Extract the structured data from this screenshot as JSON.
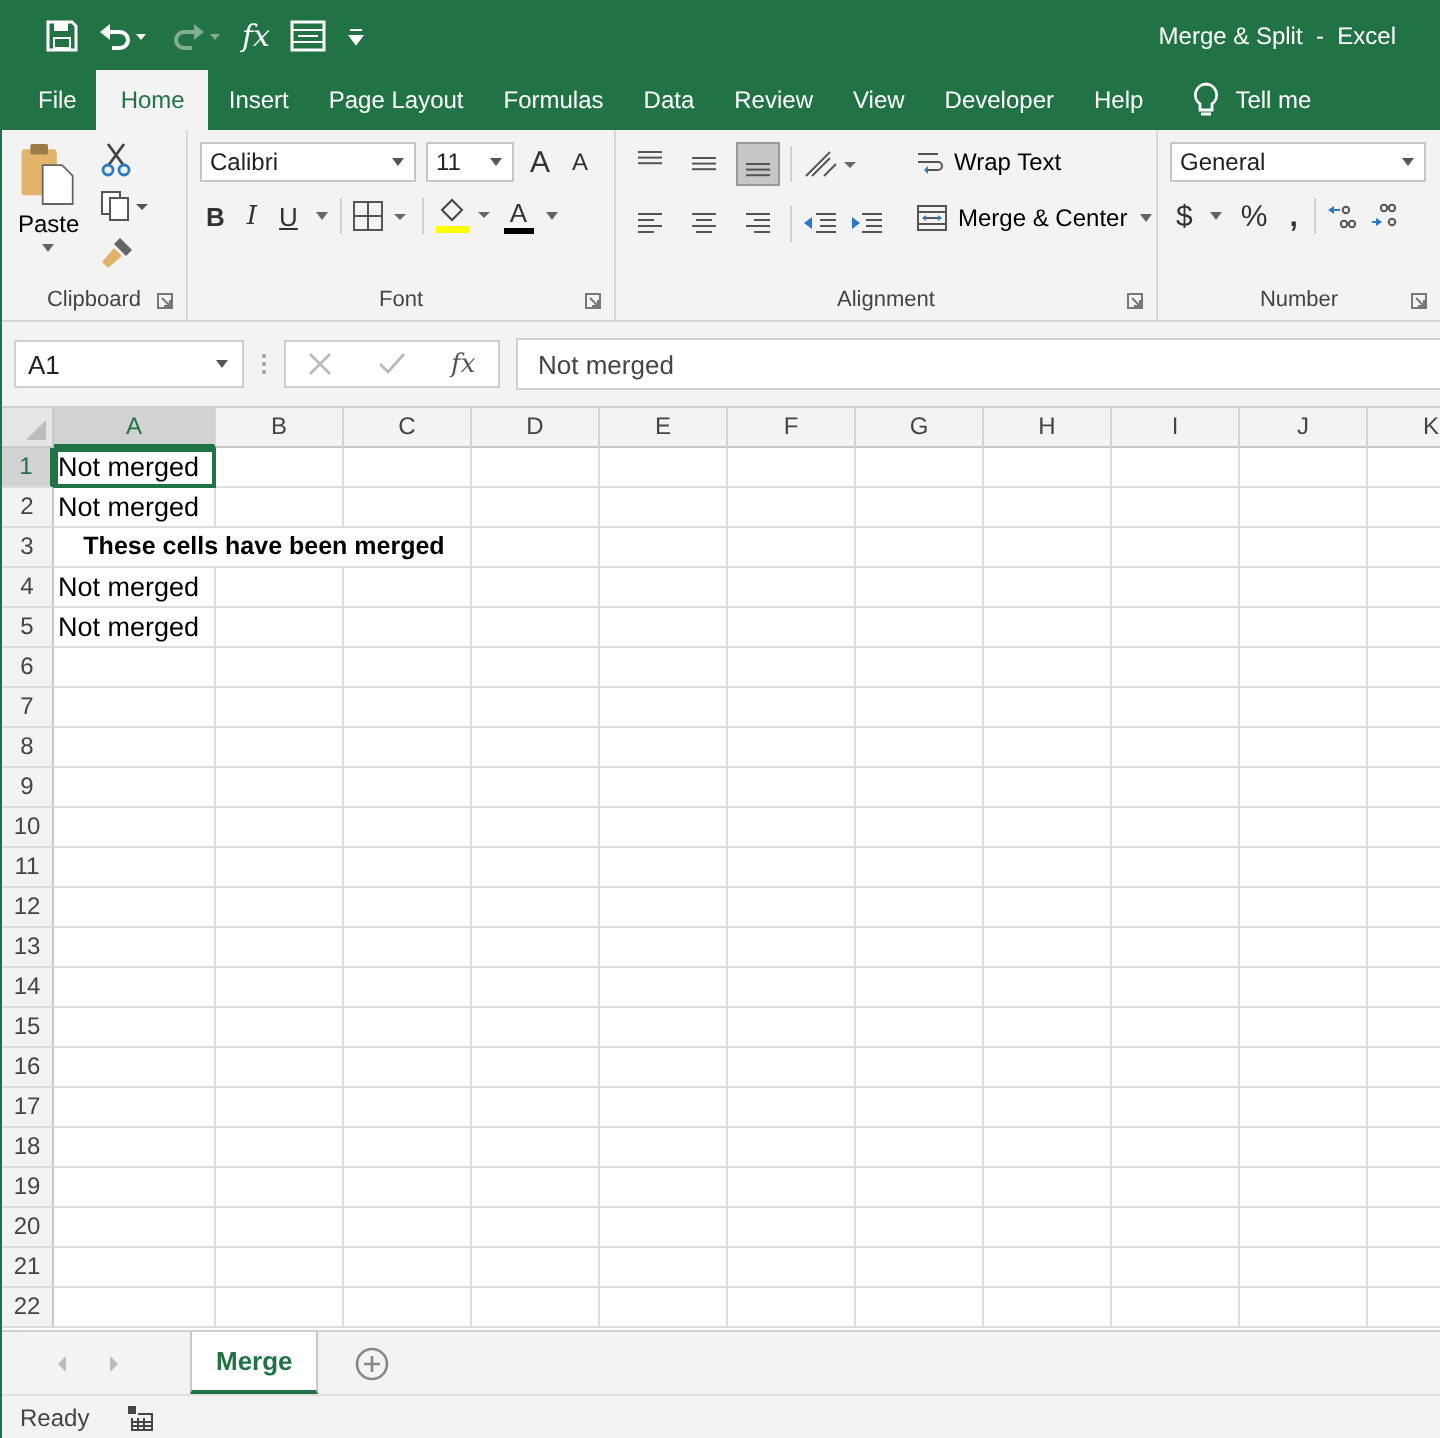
{
  "window": {
    "title": "Merge & Split  -  Excel"
  },
  "quick_access_toolbar": {
    "function_label": "fx"
  },
  "ribbon_tabs": [
    {
      "label": "File",
      "selected": false
    },
    {
      "label": "Home",
      "selected": true
    },
    {
      "label": "Insert",
      "selected": false
    },
    {
      "label": "Page Layout",
      "selected": false
    },
    {
      "label": "Formulas",
      "selected": false
    },
    {
      "label": "Data",
      "selected": false
    },
    {
      "label": "Review",
      "selected": false
    },
    {
      "label": "View",
      "selected": false
    },
    {
      "label": "Developer",
      "selected": false
    },
    {
      "label": "Help",
      "selected": false
    }
  ],
  "tell_me": {
    "label": "Tell me"
  },
  "ribbon": {
    "clipboard": {
      "paste_label": "Paste",
      "group_label": "Clipboard"
    },
    "font": {
      "font_name": "Calibri",
      "font_size": "11",
      "grow_label": "A",
      "shrink_label": "A",
      "bold_label": "B",
      "italic_label": "I",
      "underline_label": "U",
      "font_color_label": "A",
      "group_label": "Font"
    },
    "alignment": {
      "vertical_align": [
        {
          "selected": false
        },
        {
          "selected": false
        },
        {
          "selected": true
        }
      ],
      "horizontal_align": [
        {
          "selected": false
        },
        {
          "selected": false
        },
        {
          "selected": false
        }
      ],
      "wrap_text_label": "Wrap Text",
      "merge_label": "Merge & Center",
      "group_label": "Alignment"
    },
    "number": {
      "format": "General",
      "currency_label": "$",
      "percent_label": "%",
      "comma_label": ",",
      "group_label": "Number"
    }
  },
  "formula_bar": {
    "name_box": "A1",
    "function_label": "fx",
    "value": "Not merged"
  },
  "sheet": {
    "columns": [
      {
        "label": "A",
        "selected": true
      },
      {
        "label": "B",
        "selected": false
      },
      {
        "label": "C",
        "selected": false
      },
      {
        "label": "D",
        "selected": false
      },
      {
        "label": "E",
        "selected": false
      },
      {
        "label": "F",
        "selected": false
      },
      {
        "label": "G",
        "selected": false
      },
      {
        "label": "H",
        "selected": false
      },
      {
        "label": "I",
        "selected": false
      },
      {
        "label": "J",
        "selected": false
      },
      {
        "label": "K",
        "selected": false
      }
    ],
    "rows": [
      {
        "number": "1",
        "selected": true,
        "cells": [
          {
            "text": "Not merged",
            "kind": "plain",
            "active": true
          }
        ]
      },
      {
        "number": "2",
        "selected": false,
        "cells": [
          {
            "text": "Not merged",
            "kind": "plain",
            "active": false
          }
        ]
      },
      {
        "number": "3",
        "selected": false,
        "cells": [
          {
            "text": "These cells have been merged",
            "kind": "merged",
            "active": false
          }
        ]
      },
      {
        "number": "4",
        "selected": false,
        "cells": [
          {
            "text": "Not merged",
            "kind": "plain",
            "active": false
          }
        ]
      },
      {
        "number": "5",
        "selected": false,
        "cells": [
          {
            "text": "Not merged",
            "kind": "plain",
            "active": false
          }
        ]
      },
      {
        "number": "6",
        "selected": false,
        "cells": []
      },
      {
        "number": "7",
        "selected": false,
        "cells": []
      },
      {
        "number": "8",
        "selected": false,
        "cells": []
      },
      {
        "number": "9",
        "selected": false,
        "cells": []
      },
      {
        "number": "10",
        "selected": false,
        "cells": []
      },
      {
        "number": "11",
        "selected": false,
        "cells": []
      },
      {
        "number": "12",
        "selected": false,
        "cells": []
      },
      {
        "number": "13",
        "selected": false,
        "cells": []
      },
      {
        "number": "14",
        "selected": false,
        "cells": []
      },
      {
        "number": "15",
        "selected": false,
        "cells": []
      },
      {
        "number": "16",
        "selected": false,
        "cells": []
      },
      {
        "number": "17",
        "selected": false,
        "cells": []
      },
      {
        "number": "18",
        "selected": false,
        "cells": []
      },
      {
        "number": "19",
        "selected": false,
        "cells": []
      },
      {
        "number": "20",
        "selected": false,
        "cells": []
      },
      {
        "number": "21",
        "selected": false,
        "cells": []
      },
      {
        "number": "22",
        "selected": false,
        "cells": []
      }
    ]
  },
  "sheet_tabs": [
    {
      "label": "Merge",
      "selected": true
    }
  ],
  "status_bar": {
    "status": "Ready"
  }
}
